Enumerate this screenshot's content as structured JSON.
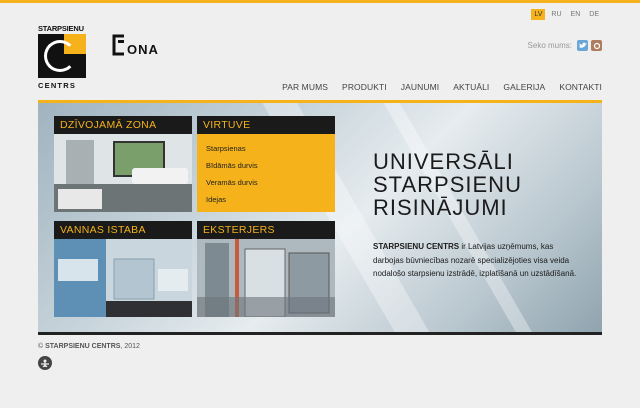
{
  "languages": [
    {
      "code": "LV",
      "active": true
    },
    {
      "code": "RU",
      "active": false
    },
    {
      "code": "EN",
      "active": false
    },
    {
      "code": "DE",
      "active": false
    }
  ],
  "logo": {
    "top": "STARPSIENU",
    "bottom": "CENTRS"
  },
  "partner_logo": {
    "text": "CONA"
  },
  "social": {
    "label": "Seko mums:",
    "icons": [
      "twitter-icon",
      "draugiem-icon"
    ]
  },
  "nav": [
    "PAR MUMS",
    "PRODUKTI",
    "JAUNUMI",
    "AKTUĀLI",
    "GALERIJA",
    "KONTAKTI"
  ],
  "tiles": {
    "living": {
      "title": "DZĪVOJAMĀ ZONA"
    },
    "kitchen": {
      "title": "VIRTUVE",
      "items": [
        "Starpsienas",
        "Bīdāmās durvis",
        "Veramās durvis",
        "Idejas"
      ]
    },
    "bath": {
      "title": "VANNAS ISTABA"
    },
    "exterior": {
      "title": "EKSTERJERS"
    }
  },
  "headline": {
    "line1": "UNIVERSĀLI",
    "line2": "STARPSIENU",
    "line3": "RISINĀJUMI"
  },
  "description": {
    "brand": "STARPSIENU CENTRS",
    "text": " ir Latvijas uzņēmums, kas darbojas būvniecības nozarē specializējoties visa veida nodalošo starpsienu izstrādē, izplatīšanā un uzstādīšanā."
  },
  "footer": {
    "copyright_prefix": "© ",
    "brand": "STARPSIENU CENTRS",
    "year": ", 2012"
  },
  "colors": {
    "accent": "#f5b21a",
    "dark": "#1a1a1a",
    "background": "#efefef"
  }
}
